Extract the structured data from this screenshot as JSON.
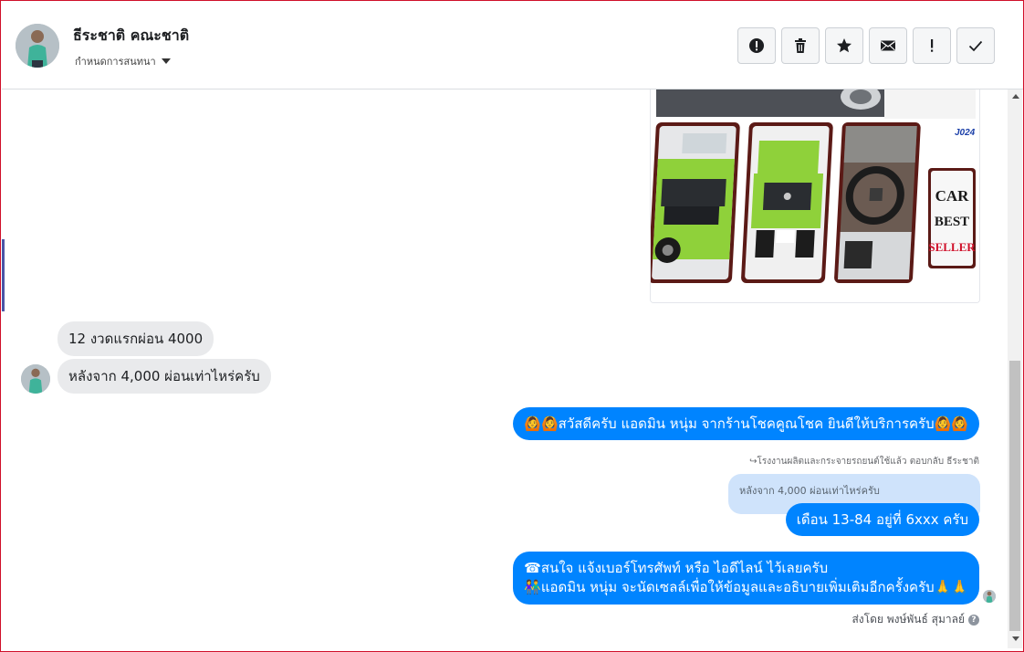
{
  "header": {
    "name": "ธีระชาติ คณะชาติ",
    "assign_label": "กำหนดการสนทนา",
    "actions": [
      {
        "name": "spam-icon"
      },
      {
        "name": "trash-icon"
      },
      {
        "name": "star-icon"
      },
      {
        "name": "envelope-icon"
      },
      {
        "name": "exclamation-icon"
      },
      {
        "name": "check-icon"
      }
    ]
  },
  "attachment": {
    "badge": "J024",
    "sign_lines": [
      "CAR",
      "BEST",
      "SELLER"
    ]
  },
  "messages": {
    "in_1": "12 งวดแรกผ่อน 4000",
    "in_2": "หลังจาก 4,000 ผ่อนเท่าไหร่ครับ",
    "out_1": "🙆🙆สวัสดีครับ แอดมิน หนุ่ม จากร้านโชคคูณโชค ยินดีให้บริการครับ🙆🙆",
    "reply_note": "↪โรงงานผลิตและกระจายรถยนต์ใช้แล้ว ตอบกลับ ธีระชาติ",
    "quoted": "หลังจาก 4,000 ผ่อนเท่าไหร่ครับ",
    "out_2": "เดือน 13-84 อยู่ที่ 6xxx ครับ",
    "out_3_line1": "☎สนใจ แจ้งเบอร์โทรศัพท์ หรือ ไอดีไลน์  ไว้เลยครับ",
    "out_3_line2": "👫แอดมิน หนุ่ม จะนัดเซลล์เพื่อให้ข้อมูลและอธิบายเพิ่มเติมอีกครั้งครับ🙏🙏",
    "sent_by": "ส่งโดย พงษ์พันธ์ สุมาลย์"
  },
  "colors": {
    "accent": "#0084ff",
    "incoming": "#e9eaec",
    "quoted": "#cfe3fb",
    "car_green": "#8fd13a"
  }
}
